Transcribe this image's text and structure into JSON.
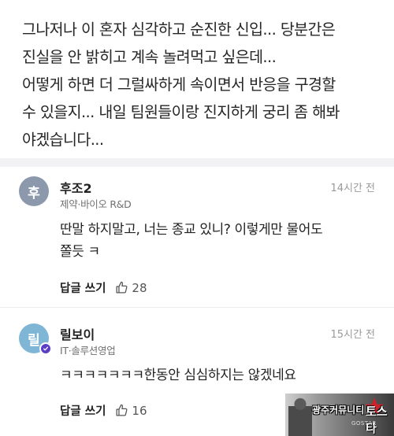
{
  "post": {
    "lines": [
      "그나저나 이 혼자 심각하고 순진한 신입... 당분간은",
      "진실을 안 밝히고 계속 놀려먹고 싶은데...",
      "어떻게 하면 더 그럴싸하게 속이면서 반응을 구경할",
      "수 있을지...  내일 팀원들이랑 진지하게 궁리 좀 해봐",
      "야겠습니다..."
    ]
  },
  "comments": [
    {
      "avatar_letter": "후",
      "avatar_color": "#8c99ad",
      "nickname": "후조2",
      "department": "제약·바이오 R&D",
      "time": "14시간 전",
      "text_lines": [
        "딴말 하지말고,  너는 종교 있니? 이렇게만 물어도",
        "쫄듯 ㅋ"
      ],
      "reply_label": "답글 쓰기",
      "like_icon": "thumbs-up-icon",
      "likes": "28"
    },
    {
      "avatar_letter": "릴",
      "avatar_color": "#7fb6d6",
      "badge_icon": "verified-badge-icon",
      "badge_color": "#5b3ec8",
      "nickname": "릴보이",
      "department": "IT·솔루션영업",
      "time": "15시간 전",
      "text_lines": [
        "ㅋㅋㅋㅋㅋㅋㅋ한동안 심심하지는 않겠네요"
      ],
      "reply_label": "답글 쓰기",
      "like_icon": "thumbs-up-icon",
      "likes": "16"
    }
  ],
  "watermark": {
    "text": "광주커뮤니티",
    "brand": "토스타",
    "sub": "GOSTAR",
    "accent_color": "#d0202a"
  }
}
